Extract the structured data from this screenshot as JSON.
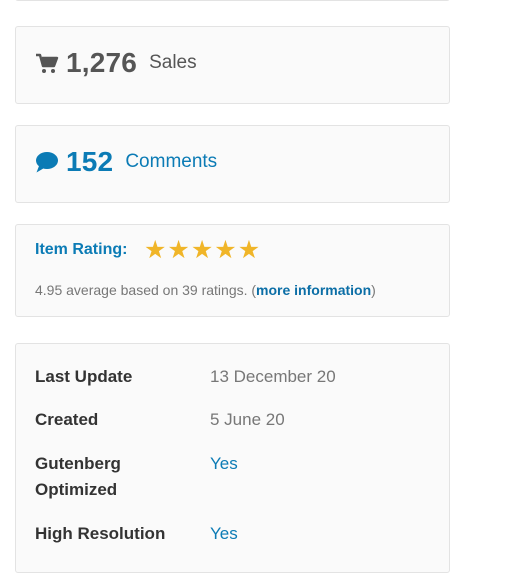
{
  "sales": {
    "count": "1,276",
    "label": "Sales"
  },
  "comments": {
    "count": "152",
    "label": "Comments"
  },
  "rating": {
    "title": "Item Rating:",
    "stars": 5,
    "summary_prefix": "4.95 average based on 39 ratings. (",
    "more_info_label": "more information",
    "summary_suffix": ")"
  },
  "meta": [
    {
      "label": "Last Update",
      "value": "13 December 20"
    },
    {
      "label": "Created",
      "value": "5 June 20"
    },
    {
      "label": "Gutenberg Optimized",
      "value": "Yes"
    },
    {
      "label": "High Resolution",
      "value": "Yes"
    }
  ],
  "colors": {
    "accent": "#0b7bb5",
    "star": "#f0b528",
    "muted": "#777777"
  },
  "icons": {
    "sales": "cart-icon",
    "comments": "speech-bubble-icon",
    "rating": "star-icon"
  }
}
